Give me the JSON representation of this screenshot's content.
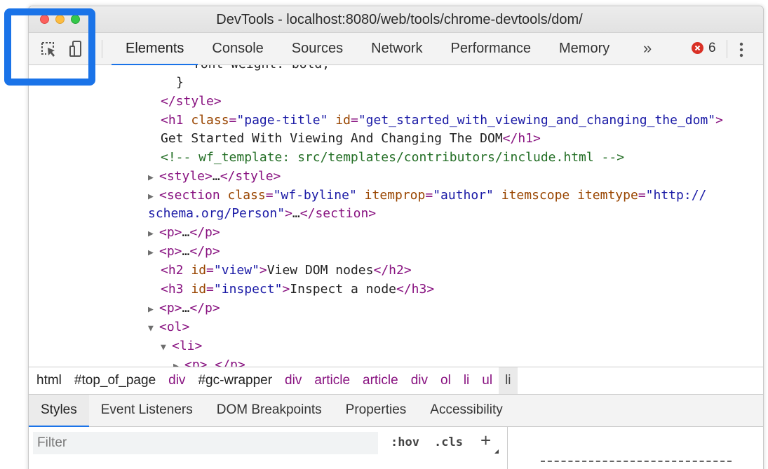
{
  "window": {
    "title": "DevTools - localhost:8080/web/tools/chrome-devtools/dom/"
  },
  "toolbar": {
    "inspect_icon": "select-element-icon",
    "device_icon": "device-toolbar-icon",
    "tabs": [
      {
        "label": "Elements"
      },
      {
        "label": "Console"
      },
      {
        "label": "Sources"
      },
      {
        "label": "Network"
      },
      {
        "label": "Performance"
      },
      {
        "label": "Memory"
      }
    ],
    "more_tabs": "»",
    "error_count": "6",
    "menu_icon": "kebab-menu-icon"
  },
  "dom": {
    "lines": [
      {
        "text": "font-weight: bold;"
      },
      {
        "text": "}"
      },
      {
        "close": "</style>"
      },
      {
        "open": "<h1 ",
        "a1": "class",
        "v1": "\"page-title\"",
        "a2": "id",
        "v2": "\"get_started_with_viewing_and_changing_the_dom\"",
        "end": ">"
      },
      {
        "text": "Get Started With Viewing And Changing The DOM",
        "close": "</h1>"
      },
      {
        "comment": "<!-- wf_template: src/templates/contributors/include.html -->"
      },
      {
        "tag": "<style>",
        "ellipsis": "…",
        "close": "</style>"
      },
      {
        "open": "<section ",
        "a1": "class",
        "v1": "\"wf-byline\"",
        "a2": "itemprop",
        "v2": "\"author\"",
        "a3": "itemscope",
        "a4": "itemtype",
        "v4": "\"http://"
      },
      {
        "v": "schema.org/Person\"",
        "end": ">",
        "ellipsis": "…",
        "close": "</section>"
      },
      {
        "tag": "<p>",
        "ellipsis": "…",
        "close": "</p>"
      },
      {
        "tag": "<p>",
        "ellipsis": "…",
        "close": "</p>"
      },
      {
        "open": "<h2 ",
        "a1": "id",
        "v1": "\"view\"",
        "end": ">",
        "text": "View DOM nodes",
        "close": "</h2>"
      },
      {
        "open": "<h3 ",
        "a1": "id",
        "v1": "\"inspect\"",
        "end": ">",
        "text": "Inspect a node",
        "close": "</h3>"
      },
      {
        "tag": "<p>",
        "ellipsis": "…",
        "close": "</p>"
      },
      {
        "tag": "<ol>"
      },
      {
        "tag": "<li>"
      },
      {
        "tag": "<p>",
        "ellipsis": "…",
        "close": "</p>"
      }
    ]
  },
  "breadcrumbs": [
    {
      "label": "html"
    },
    {
      "label": "#top_of_page"
    },
    {
      "label": "div"
    },
    {
      "label": "#gc-wrapper"
    },
    {
      "label": "div"
    },
    {
      "label": "article"
    },
    {
      "label": "article"
    },
    {
      "label": "div"
    },
    {
      "label": "ol"
    },
    {
      "label": "li"
    },
    {
      "label": "ul"
    },
    {
      "label": "li"
    }
  ],
  "subtabs": [
    {
      "label": "Styles"
    },
    {
      "label": "Event Listeners"
    },
    {
      "label": "DOM Breakpoints"
    },
    {
      "label": "Properties"
    },
    {
      "label": "Accessibility"
    }
  ],
  "styles": {
    "filter_placeholder": "Filter",
    "hov_label": ":hov",
    "cls_label": ".cls",
    "add_rule_label": "+"
  },
  "colors": {
    "accent": "#1a73e8",
    "tag": "#881280",
    "attribute": "#994500",
    "value": "#1a1aa6",
    "comment": "#236e25",
    "error": "#d93025"
  }
}
